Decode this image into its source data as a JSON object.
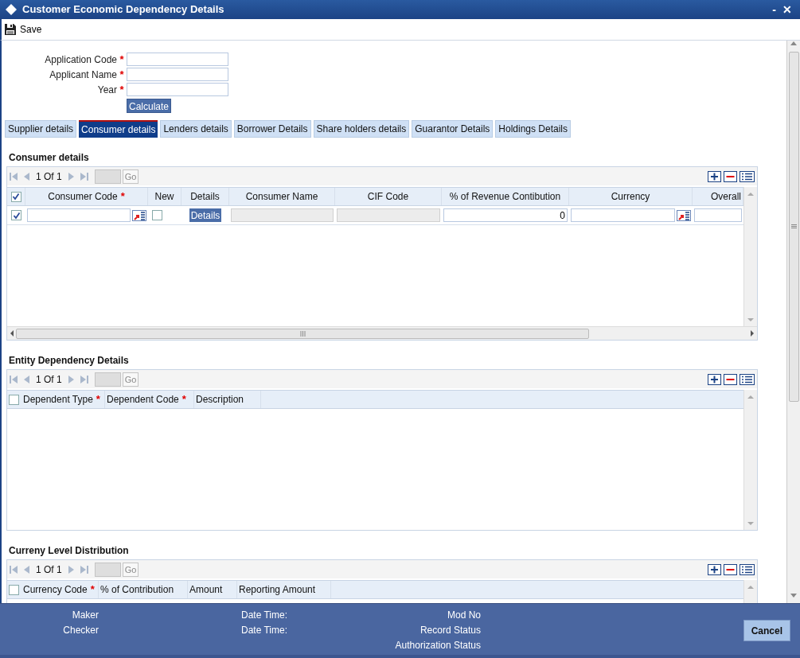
{
  "window": {
    "title": "Customer Economic Dependency Details",
    "buttons": [
      "-",
      "✕"
    ]
  },
  "toolbar": [
    {
      "label": "Save"
    }
  ],
  "form": {
    "fields": [
      {
        "label": "Application Code",
        "mark": "*"
      },
      {
        "label": "Applicant Name",
        "mark": "*"
      },
      {
        "label": "Year",
        "mark": "*"
      }
    ],
    "button": "Calculate"
  },
  "tabs": [
    {
      "label": "Supplier details",
      "selected": false
    },
    {
      "label": "Consumer details",
      "selected": true
    },
    {
      "label": "Lenders details",
      "selected": false
    },
    {
      "label": "Borrower Details",
      "selected": false
    },
    {
      "label": "Share holders details",
      "selected": false
    },
    {
      "label": "Guarantor Details",
      "selected": false
    },
    {
      "label": "Holdings Details",
      "selected": false
    }
  ],
  "sections": [
    {
      "title": "Consumer details",
      "pager": "1 Of 1",
      "go": "Go",
      "header_checked": true,
      "columns": [
        {
          "label": "Consumer Code",
          "mark": "*"
        },
        {
          "label": "New"
        },
        {
          "label": "Details"
        },
        {
          "label": "Consumer Name"
        },
        {
          "label": "CIF Code"
        },
        {
          "label": "% of Revenue Contibution"
        },
        {
          "label": "Currency"
        },
        {
          "label": "Overall"
        }
      ],
      "rows": [
        {
          "checked": true,
          "cells": [
            {
              "kind": "lov"
            },
            {
              "kind": "checkbox",
              "checked": false
            },
            {
              "kind": "button",
              "text": "Details"
            },
            {
              "kind": "readonly"
            },
            {
              "kind": "readonly"
            },
            {
              "kind": "number",
              "text": "0"
            },
            {
              "kind": "lov"
            },
            {
              "kind": "text"
            }
          ]
        }
      ]
    },
    {
      "title": "Entity Dependency Details",
      "pager": "1 Of 1",
      "go": "Go",
      "header_checked": false,
      "columns": [
        {
          "label": "Dependent Type",
          "mark": "*"
        },
        {
          "label": "Dependent Code",
          "mark": "*"
        },
        {
          "label": "Description"
        }
      ]
    },
    {
      "title": "Curreny Level Distribution",
      "pager": "1 Of 1",
      "go": "Go",
      "header_checked": false,
      "columns": [
        {
          "label": "Currency Code",
          "mark": "*"
        },
        {
          "label": "% of Contribution"
        },
        {
          "label": "Amount"
        },
        {
          "label": "Reporting Amount"
        }
      ]
    }
  ],
  "footer": {
    "columns": [
      [
        "Maker",
        "Checker"
      ],
      [
        "Date Time:",
        "Date Time:"
      ],
      [
        "Mod No",
        "Record Status",
        "Authorization Status"
      ]
    ],
    "button": "Cancel"
  }
}
